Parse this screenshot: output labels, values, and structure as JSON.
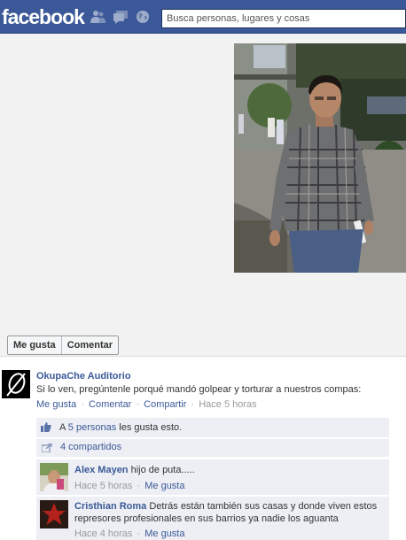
{
  "header": {
    "logo": "facebook",
    "search_placeholder": "Busca personas, lugares y cosas",
    "icons": [
      "friend-requests-icon",
      "messages-icon",
      "notifications-globe-icon"
    ]
  },
  "photo": {
    "actions": {
      "like": "Me gusta",
      "comment": "Comentar"
    }
  },
  "post": {
    "author": "OkupaChe Auditorio",
    "text": "Si lo ven, pregúntenle porqué mandó golpear y torturar a nuestros compas:",
    "actions": {
      "like": "Me gusta",
      "comment": "Comentar",
      "share": "Compartir"
    },
    "time": "Hace 5 horas"
  },
  "ufi": {
    "likes_prefix": "A",
    "likes_link": "5 personas",
    "likes_suffix": "les gusta esto.",
    "shares": "4 compartidos"
  },
  "comments": [
    {
      "name": "Alex Mayen",
      "text": "hijo de puta.....",
      "time": "Hace 5 horas",
      "like": "Me gusta"
    },
    {
      "name": "Cristhian Roma",
      "text": "Detrás están también sus casas y donde viven estos represores profesionales en sus barrios ya nadie los aguanta",
      "time": "Hace 4 horas",
      "like": "Me gusta"
    }
  ],
  "separator": "·"
}
